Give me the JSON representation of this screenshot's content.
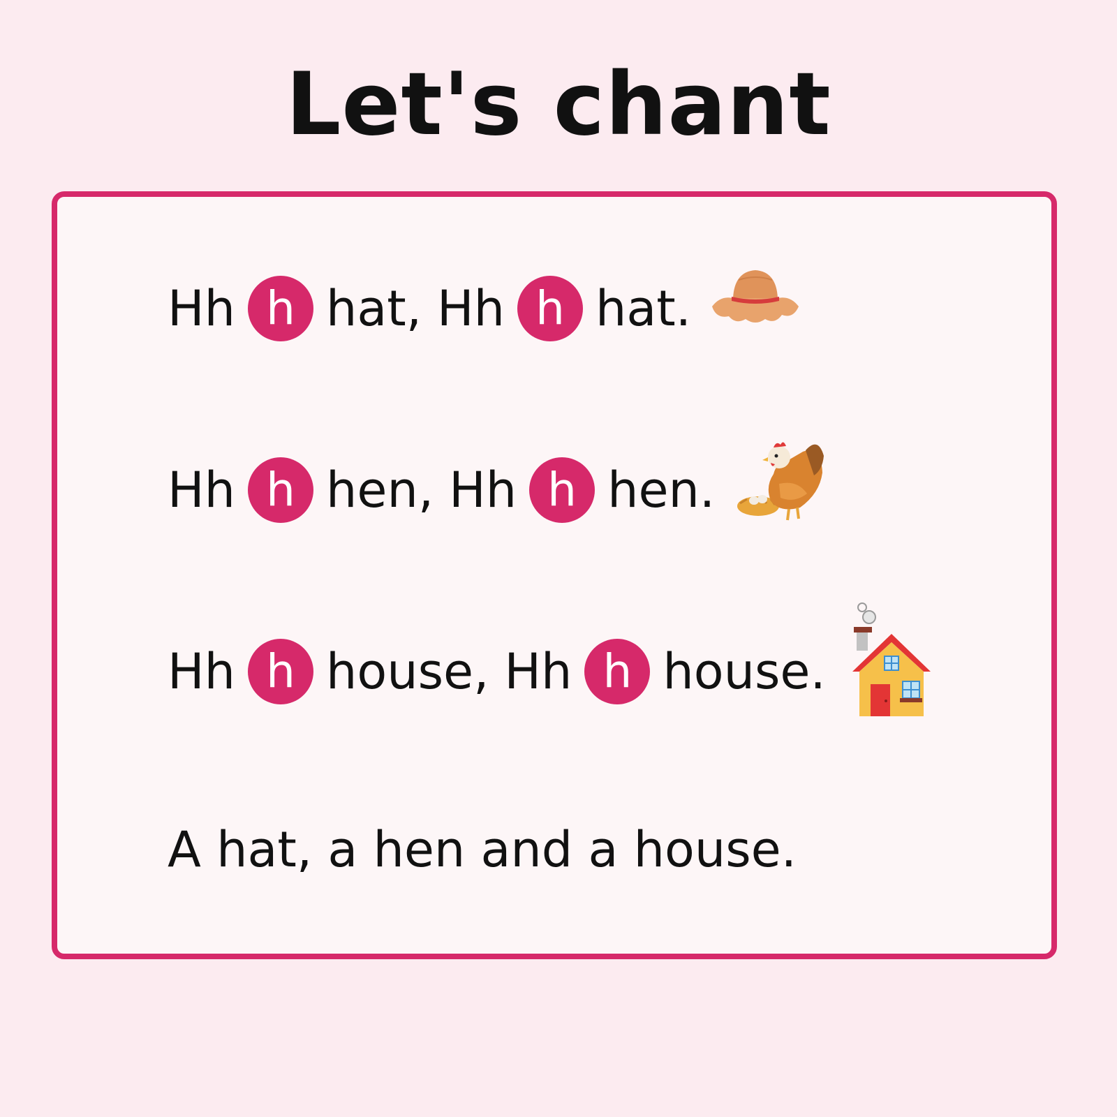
{
  "title": "Let's chant",
  "lines": [
    {
      "hh1": "Hh",
      "badge1": "h",
      "word1": "hat,",
      "hh2": "Hh",
      "badge2": "h",
      "word2": "hat.",
      "icon": "hat-icon"
    },
    {
      "hh1": "Hh",
      "badge1": "h",
      "word1": "hen,",
      "hh2": "Hh",
      "badge2": "h",
      "word2": "hen.",
      "icon": "hen-icon"
    },
    {
      "hh1": "Hh",
      "badge1": "h",
      "word1": "house,",
      "hh2": "Hh",
      "badge2": "h",
      "word2": "house.",
      "icon": "house-icon"
    }
  ],
  "closing": "A hat, a hen and a house.",
  "colors": {
    "accent": "#d6296a",
    "background": "#fcebf0",
    "card": "#fdf6f7",
    "text": "#111111"
  }
}
